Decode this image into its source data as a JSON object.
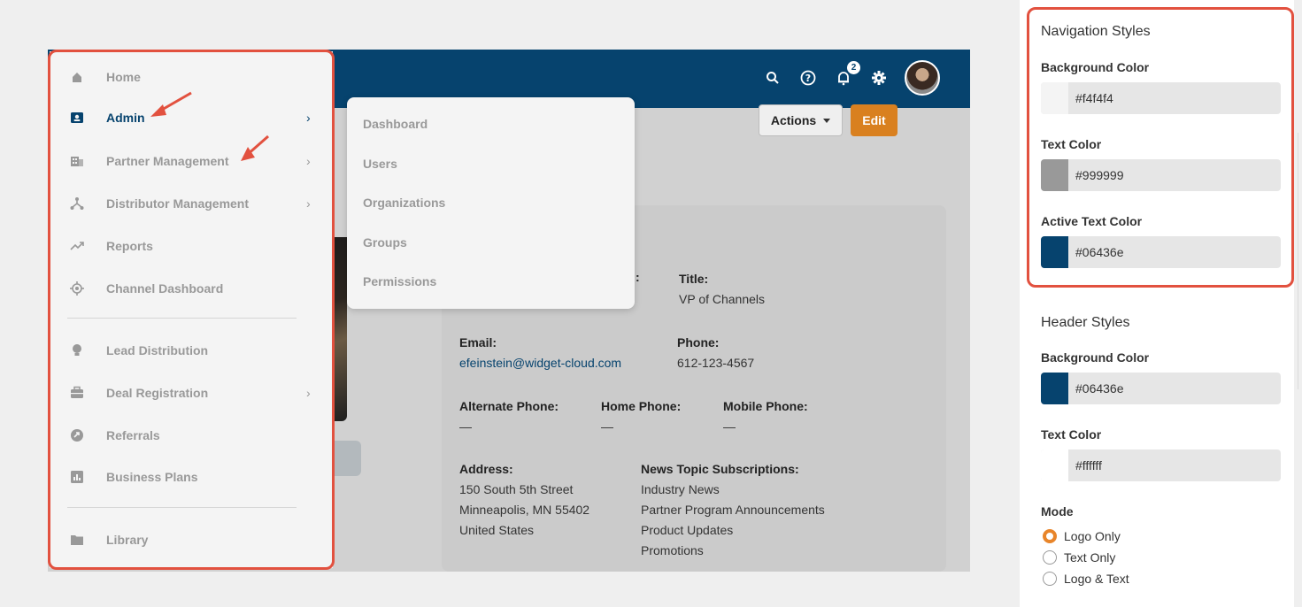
{
  "header": {
    "notification_count": "2"
  },
  "sidebar": {
    "items": [
      {
        "label": "Home",
        "icon": "home-icon",
        "active": false,
        "chevron": false
      },
      {
        "label": "Admin",
        "icon": "id-card-icon",
        "active": true,
        "chevron": true
      },
      {
        "label": "Partner Management",
        "icon": "building-icon",
        "active": false,
        "chevron": true
      },
      {
        "label": "Distributor Management",
        "icon": "network-icon",
        "active": false,
        "chevron": true
      },
      {
        "label": "Reports",
        "icon": "trending-icon",
        "active": false,
        "chevron": false
      },
      {
        "label": "Channel Dashboard",
        "icon": "target-icon",
        "active": false,
        "chevron": false
      },
      {
        "label": "Lead Distribution",
        "icon": "lightbulb-icon",
        "active": false,
        "chevron": false
      },
      {
        "label": "Deal Registration",
        "icon": "briefcase-icon",
        "active": false,
        "chevron": true
      },
      {
        "label": "Referrals",
        "icon": "referral-icon",
        "active": false,
        "chevron": false
      },
      {
        "label": "Business Plans",
        "icon": "bar-chart-icon",
        "active": false,
        "chevron": false
      },
      {
        "label": "Library",
        "icon": "folder-icon",
        "active": false,
        "chevron": false
      }
    ]
  },
  "submenu": {
    "items": [
      "Dashboard",
      "Users",
      "Organizations",
      "Groups",
      "Permissions"
    ]
  },
  "profile": {
    "partner_tag_fragment": "er",
    "colon_fragment": ":",
    "actions_label": "Actions",
    "edit_label": "Edit",
    "title_label": "Title:",
    "title_value": "VP of Channels",
    "email_label": "Email:",
    "email_value": "efeinstein@widget-cloud.com",
    "phone_label": "Phone:",
    "phone_value": "612-123-4567",
    "alt_phone_label": "Alternate Phone:",
    "alt_phone_value": "—",
    "home_phone_label": "Home Phone:",
    "home_phone_value": "—",
    "mobile_phone_label": "Mobile Phone:",
    "mobile_phone_value": "—",
    "address_label": "Address:",
    "address_lines": [
      "150 South 5th Street",
      "Minneapolis, MN 55402",
      "United States"
    ],
    "subscriptions_label": "News Topic Subscriptions:",
    "subscriptions": [
      "Industry News",
      "Partner Program Announcements",
      "Product Updates",
      "Promotions"
    ]
  },
  "panel": {
    "nav_styles_title": "Navigation Styles",
    "nav_bg_label": "Background Color",
    "nav_bg_value": "#f4f4f4",
    "nav_text_label": "Text Color",
    "nav_text_value": "#999999",
    "nav_active_label": "Active Text Color",
    "nav_active_value": "#06436e",
    "header_styles_title": "Header Styles",
    "hdr_bg_label": "Background Color",
    "hdr_bg_value": "#06436e",
    "hdr_text_label": "Text Color",
    "hdr_text_value": "#ffffff",
    "mode_label": "Mode",
    "mode_options": [
      "Logo Only",
      "Text Only",
      "Logo & Text"
    ],
    "mode_selected": "Logo Only"
  },
  "colors": {
    "nav_bg": "#f4f4f4",
    "nav_text": "#999999",
    "active": "#06436e",
    "header_bg": "#06436e",
    "accent_orange": "#d9801f",
    "annotation_red": "#e2513f"
  }
}
